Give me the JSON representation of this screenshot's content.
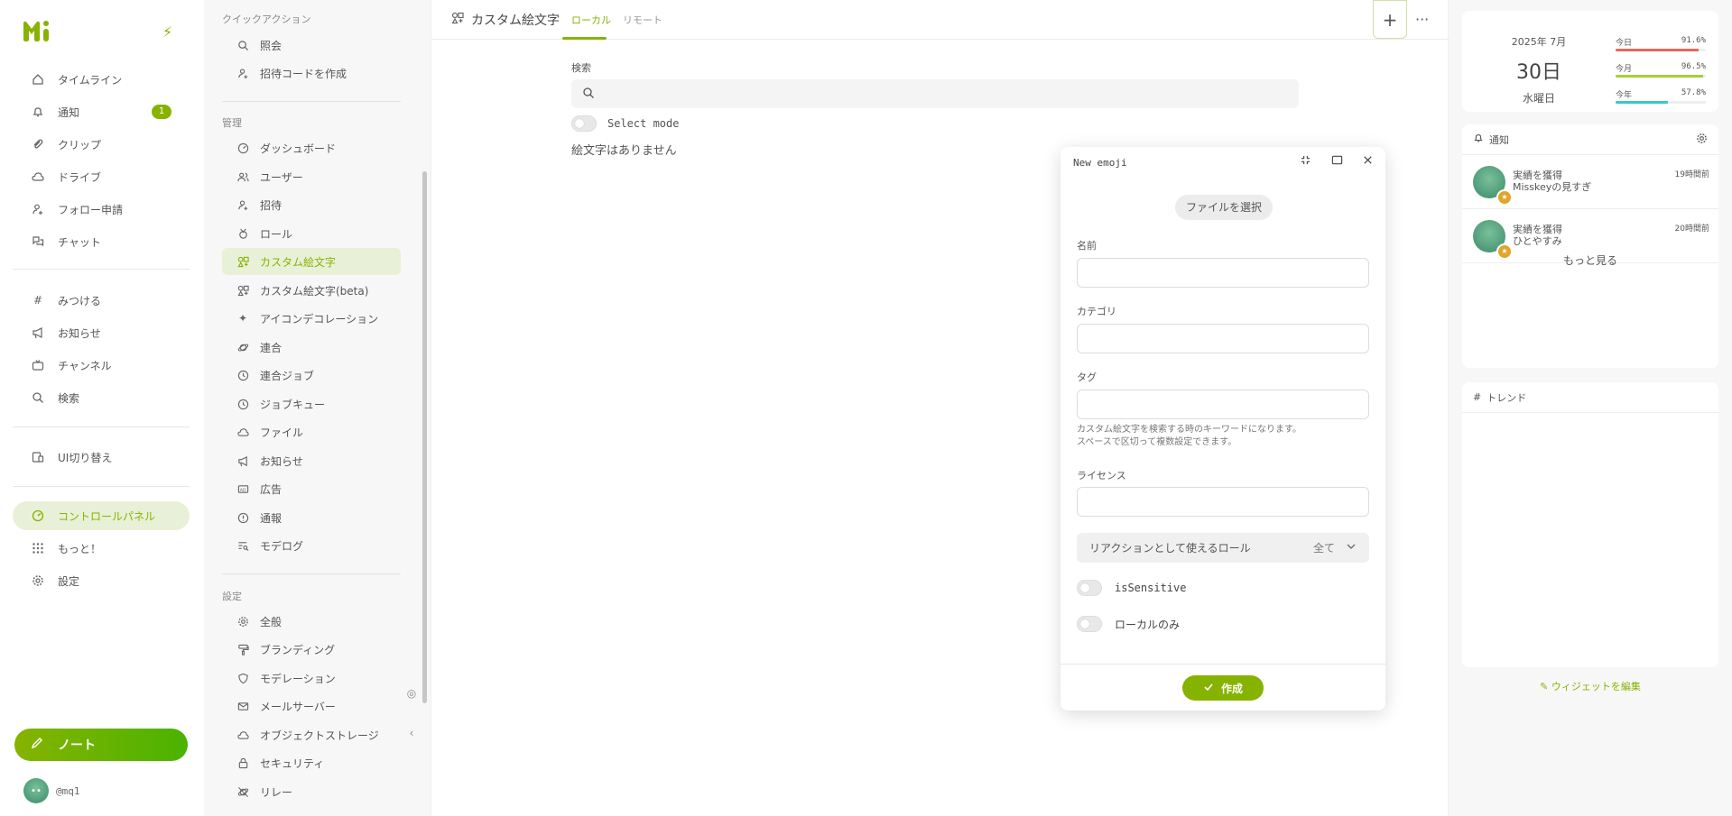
{
  "nav": {
    "items": [
      {
        "label": "タイムライン",
        "icon": "home-icon"
      },
      {
        "label": "通知",
        "icon": "bell-icon",
        "badge": "1"
      },
      {
        "label": "クリップ",
        "icon": "paperclip-icon"
      },
      {
        "label": "ドライブ",
        "icon": "cloud-icon"
      },
      {
        "label": "フォロー申請",
        "icon": "user-plus-icon"
      },
      {
        "label": "チャット",
        "icon": "chat-icon"
      },
      {
        "label": "みつける",
        "icon": "hashtag-icon"
      },
      {
        "label": "お知らせ",
        "icon": "megaphone-icon"
      },
      {
        "label": "チャンネル",
        "icon": "tv-icon"
      },
      {
        "label": "検索",
        "icon": "search-icon"
      },
      {
        "label": "UI切り替え",
        "icon": "devices-icon"
      },
      {
        "label": "コントロールパネル",
        "icon": "gauge-icon"
      },
      {
        "label": "もっと！",
        "icon": "grid-dots-icon"
      },
      {
        "label": "設定",
        "icon": "gear-icon"
      }
    ],
    "note_label": "ノート",
    "username": "@mq1"
  },
  "admin": {
    "quick_actions_title": "クイックアクション",
    "quick_actions": [
      {
        "label": "照会",
        "icon": "search-icon"
      },
      {
        "label": "招待コードを作成",
        "icon": "user-plus-icon"
      }
    ],
    "manage_title": "管理",
    "manage": [
      {
        "label": "ダッシュボード",
        "icon": "gauge-icon"
      },
      {
        "label": "ユーザー",
        "icon": "users-icon"
      },
      {
        "label": "招待",
        "icon": "user-plus-icon"
      },
      {
        "label": "ロール",
        "icon": "badge-icon"
      },
      {
        "label": "カスタム絵文字",
        "icon": "icons-icon"
      },
      {
        "label": "カスタム絵文字(beta)",
        "icon": "icons-icon"
      },
      {
        "label": "アイコンデコレーション",
        "icon": "sparkles-icon"
      },
      {
        "label": "連合",
        "icon": "planet-icon"
      },
      {
        "label": "連合ジョブ",
        "icon": "clock-icon"
      },
      {
        "label": "ジョブキュー",
        "icon": "clock-play-icon"
      },
      {
        "label": "ファイル",
        "icon": "cloud-icon"
      },
      {
        "label": "お知らせ",
        "icon": "megaphone-icon"
      },
      {
        "label": "広告",
        "icon": "ad-icon"
      },
      {
        "label": "通報",
        "icon": "exclamation-circle-icon"
      },
      {
        "label": "モデログ",
        "icon": "list-search-icon"
      }
    ],
    "settings_title": "設定",
    "settings": [
      {
        "label": "全般",
        "icon": "gear-icon"
      },
      {
        "label": "ブランディング",
        "icon": "paint-icon"
      },
      {
        "label": "モデレーション",
        "icon": "shield-icon"
      },
      {
        "label": "メールサーバー",
        "icon": "mail-icon"
      },
      {
        "label": "オブジェクトストレージ",
        "icon": "cloud-icon"
      },
      {
        "label": "セキュリティ",
        "icon": "lock-icon"
      },
      {
        "label": "リレー",
        "icon": "planet-off-icon"
      }
    ]
  },
  "main": {
    "title": "カスタム絵文字",
    "tabs": [
      {
        "label": "ローカル",
        "active": true
      },
      {
        "label": "リモート",
        "active": false
      }
    ],
    "plus_label": "+",
    "more_label": "···",
    "search_label": "検索",
    "search_value": "",
    "select_mode_label": "Select mode",
    "empty_text": "絵文字はありません"
  },
  "modal": {
    "title": "New emoji",
    "file_button": "ファイルを選択",
    "name_label": "名前",
    "category_label": "カテゴリ",
    "tag_label": "タグ",
    "tag_help": "カスタム絵文字を検索する時のキーワードになります。スペースで区切って複数設定できます。",
    "tag_help_line1": "カスタム絵文字を検索する時のキーワードになります。",
    "tag_help_line2": "スペースで区切って複数設定できます。",
    "license_label": "ライセンス",
    "role_label": "リアクションとして使えるロール",
    "role_value": "全て",
    "sensitive_label": "isSensitive",
    "local_only_label": "ローカルのみ",
    "create_label": "作成"
  },
  "widgets": {
    "calendar": {
      "year_month": "2025年 7月",
      "day": "30日",
      "weekday": "水曜日",
      "progress": [
        {
          "label": "今日",
          "percent": "91.6%",
          "value": 91.6,
          "color": "#e8685a"
        },
        {
          "label": "今月",
          "percent": "96.5%",
          "value": 96.5,
          "color": "#a6d136"
        },
        {
          "label": "今年",
          "percent": "57.8%",
          "value": 57.8,
          "color": "#36c9d1"
        }
      ]
    },
    "notifications": {
      "title": "通知",
      "items": [
        {
          "title": "実績を獲得",
          "detail": "Misskeyの見すぎ",
          "time": "19時間前"
        },
        {
          "title": "実績を獲得",
          "detail": "ひとやすみ",
          "time": "20時間前"
        }
      ],
      "more_label": "もっと見る"
    },
    "trends": {
      "title": "トレンド"
    },
    "edit_label": "ウィジェットを編集"
  },
  "colors": {
    "accent": "#86b300",
    "accent_bg": "#e9f0d8"
  }
}
